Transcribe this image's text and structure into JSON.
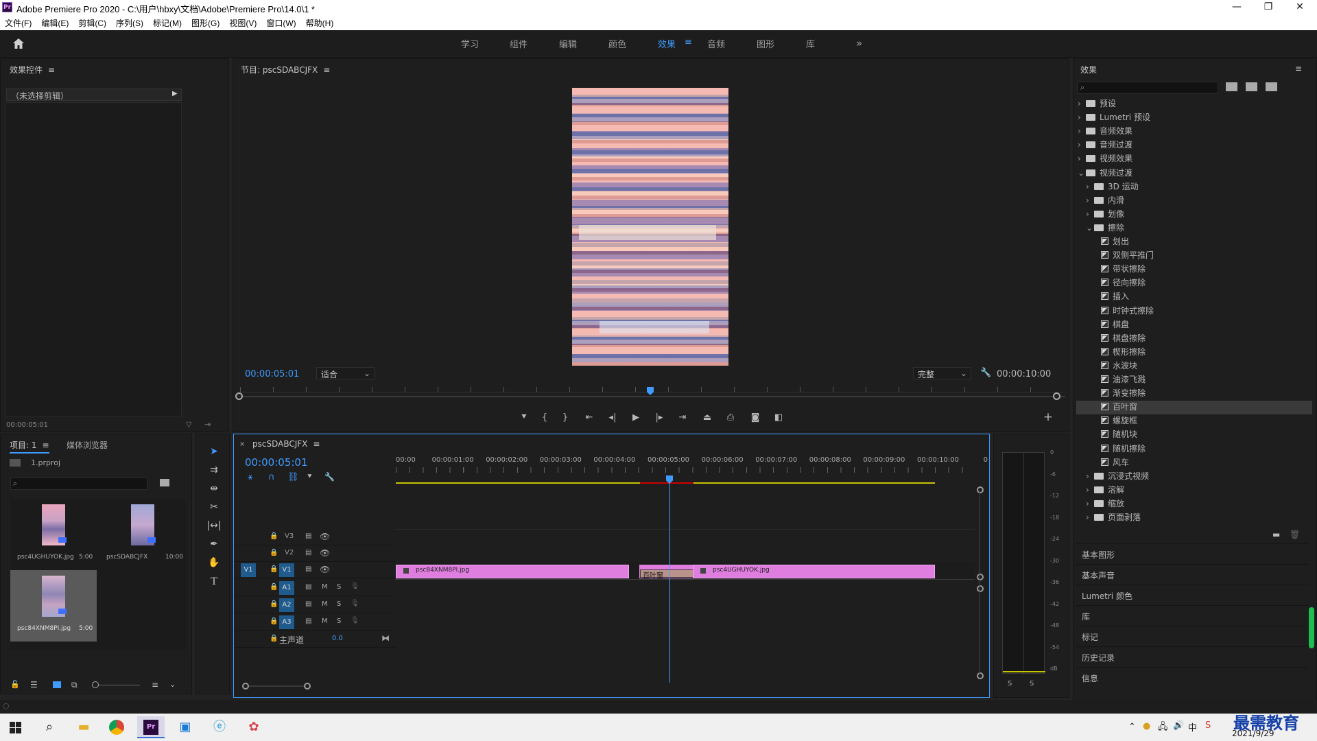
{
  "window": {
    "title": "Adobe Premiere Pro 2020 - C:\\用户\\hbxy\\文档\\Adobe\\Premiere Pro\\14.0\\1 *",
    "logo": "Pr"
  },
  "menu": [
    "文件(F)",
    "编辑(E)",
    "剪辑(C)",
    "序列(S)",
    "标记(M)",
    "图形(G)",
    "视图(V)",
    "窗口(W)",
    "帮助(H)"
  ],
  "workspaces": [
    "学习",
    "组件",
    "编辑",
    "颜色",
    "效果",
    "音频",
    "图形",
    "库"
  ],
  "active_workspace": "效果",
  "effect_controls": {
    "title": "效果控件",
    "no_clip": "（未选择剪辑）",
    "timecode": "00:00:05:01"
  },
  "program": {
    "title": "节目: pscSDABCJFX",
    "timecode_left": "00:00:05:01",
    "fit": "适合",
    "quality": "完整",
    "timecode_right": "00:00:10:00"
  },
  "project": {
    "tab1": "项目: 1",
    "tab2": "媒体浏览器",
    "file": "1.prproj",
    "items": [
      {
        "name": "psc4UGHUYOK.jpg",
        "dur": "5:00"
      },
      {
        "name": "pscSDABCJFX",
        "dur": "10:00"
      },
      {
        "name": "psc84XNM8PI.jpg",
        "dur": "5:00"
      }
    ]
  },
  "timeline": {
    "title": "pscSDABCJFX",
    "timecode": "00:00:05:01",
    "ruler": [
      "00:00",
      "00:00:01:00",
      "00:00:02:00",
      "00:00:03:00",
      "00:00:04:00",
      "00:00:05:00",
      "00:00:06:00",
      "00:00:07:00",
      "00:00:08:00",
      "00:00:09:00",
      "00:00:10:00",
      "0"
    ],
    "tracks": {
      "v3": "V3",
      "v2": "V2",
      "v1": "V1",
      "src_v1": "V1",
      "a1": "A1",
      "a2": "A2",
      "a3": "A3",
      "m": "M",
      "s": "S",
      "master": "主声道",
      "master_val": "0.0"
    },
    "clips": {
      "clip1": "psc84XNM8PI.jpg",
      "transition": "百叶窗",
      "clip2": "psc4UGHUYOK.jpg"
    }
  },
  "meter": {
    "scale": [
      "0",
      "-6",
      "-12",
      "-18",
      "-24",
      "-30",
      "-36",
      "-42",
      "-48",
      "-54",
      "dB"
    ],
    "s1": "S",
    "s2": "S"
  },
  "effects": {
    "title": "效果",
    "tree": [
      {
        "label": "预设",
        "lvl": 0,
        "type": "folder",
        "arr": "›"
      },
      {
        "label": "Lumetri 预设",
        "lvl": 0,
        "type": "folder",
        "arr": "›"
      },
      {
        "label": "音频效果",
        "lvl": 0,
        "type": "folder",
        "arr": "›"
      },
      {
        "label": "音频过渡",
        "lvl": 0,
        "type": "folder",
        "arr": "›"
      },
      {
        "label": "视频效果",
        "lvl": 0,
        "type": "folder",
        "arr": "›"
      },
      {
        "label": "视频过渡",
        "lvl": 0,
        "type": "folder",
        "arr": "⌄"
      },
      {
        "label": "3D 运动",
        "lvl": 1,
        "type": "folder",
        "arr": "›"
      },
      {
        "label": "内滑",
        "lvl": 1,
        "type": "folder",
        "arr": "›"
      },
      {
        "label": "划像",
        "lvl": 1,
        "type": "folder",
        "arr": "›"
      },
      {
        "label": "擦除",
        "lvl": 1,
        "type": "folder",
        "arr": "⌄"
      },
      {
        "label": "划出",
        "lvl": 2,
        "type": "fx"
      },
      {
        "label": "双侧平推门",
        "lvl": 2,
        "type": "fx"
      },
      {
        "label": "带状擦除",
        "lvl": 2,
        "type": "fx"
      },
      {
        "label": "径向擦除",
        "lvl": 2,
        "type": "fx"
      },
      {
        "label": "插入",
        "lvl": 2,
        "type": "fx"
      },
      {
        "label": "时钟式擦除",
        "lvl": 2,
        "type": "fx"
      },
      {
        "label": "棋盘",
        "lvl": 2,
        "type": "fx"
      },
      {
        "label": "棋盘擦除",
        "lvl": 2,
        "type": "fx"
      },
      {
        "label": "楔形擦除",
        "lvl": 2,
        "type": "fx"
      },
      {
        "label": "水波块",
        "lvl": 2,
        "type": "fx"
      },
      {
        "label": "油漆飞溅",
        "lvl": 2,
        "type": "fx"
      },
      {
        "label": "渐变擦除",
        "lvl": 2,
        "type": "fx"
      },
      {
        "label": "百叶窗",
        "lvl": 2,
        "type": "fx",
        "sel": true
      },
      {
        "label": "螺旋框",
        "lvl": 2,
        "type": "fx"
      },
      {
        "label": "随机块",
        "lvl": 2,
        "type": "fx"
      },
      {
        "label": "随机擦除",
        "lvl": 2,
        "type": "fx"
      },
      {
        "label": "风车",
        "lvl": 2,
        "type": "fx"
      },
      {
        "label": "沉浸式视频",
        "lvl": 1,
        "type": "folder",
        "arr": "›"
      },
      {
        "label": "溶解",
        "lvl": 1,
        "type": "folder",
        "arr": "›"
      },
      {
        "label": "缩放",
        "lvl": 1,
        "type": "folder",
        "arr": "›"
      },
      {
        "label": "页面剥落",
        "lvl": 1,
        "type": "folder",
        "arr": "›"
      }
    ],
    "panels": [
      "基本图形",
      "基本声音",
      "Lumetri 颜色",
      "库",
      "标记",
      "历史记录",
      "信息"
    ]
  },
  "colors": {
    "accent": "#3f9bff",
    "clip": "#e07ee0",
    "transition": "#b9928a",
    "selection": "#1f5b8c"
  },
  "taskbar": {
    "ime": "中",
    "date": "2021/9/29",
    "watermark": "最需教育"
  }
}
